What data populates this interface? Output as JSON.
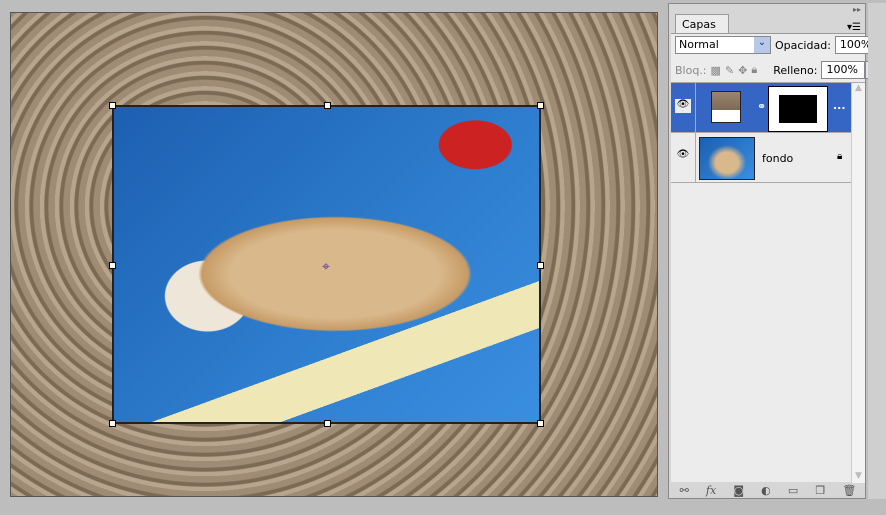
{
  "panel": {
    "tab_label": "Capas",
    "tab_close": "×",
    "blend_mode": "Normal",
    "opacity_label": "Opacidad:",
    "opacity_value": "100%",
    "lock_label": "Bloq.:",
    "fill_label": "Relleno:",
    "fill_value": "100%"
  },
  "layers": [
    {
      "name": "",
      "selected": true,
      "has_mask": true,
      "more": "..."
    },
    {
      "name": "fondo",
      "selected": false,
      "locked": true
    }
  ],
  "footer_icons": [
    "link-icon",
    "fx-icon",
    "mask-icon",
    "adjustment-icon",
    "folder-icon",
    "new-layer-icon",
    "trash-icon"
  ],
  "footer_fx": "fx",
  "colors": {
    "selection": "#3566c4",
    "panel": "#ececec"
  }
}
